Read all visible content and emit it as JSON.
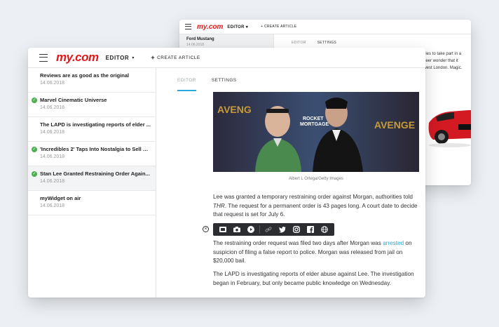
{
  "back_window": {
    "logo": "my.com",
    "editor_label": "EDITOR ▾",
    "create_label": "+ CREATE ARTICLE",
    "selected_article": {
      "title": "Ford Mustang",
      "date": "14.06.2018"
    },
    "tabs": [
      "EDITOR",
      "SETTINGS"
    ],
    "body_lines": [
      "l series to take part in a",
      "e sheer wonder that it",
      "on west London. Magic."
    ]
  },
  "header": {
    "logo": "my.com",
    "editor_label": "EDITOR",
    "caret": "▾",
    "create_plus": "+",
    "create_label": "CREATE ARTICLE"
  },
  "sidebar": {
    "items": [
      {
        "title": "Reviews are as good as the original",
        "date": "14.06.2018",
        "checked": false,
        "selected": false
      },
      {
        "title": "Marvel Cinematic Universe",
        "date": "14.06.2018",
        "checked": true,
        "selected": false
      },
      {
        "title": "The LAPD is investigating reports of elder ...",
        "date": "14.06.2018",
        "checked": false,
        "selected": false
      },
      {
        "title": "'Incredibles 2' Taps Into Nostalgia to Sell S...",
        "date": "14.06.2018",
        "checked": true,
        "selected": false
      },
      {
        "title": "Stan Lee Granted Restraining Order Again...",
        "date": "14.06.2018",
        "checked": true,
        "selected": true
      },
      {
        "title": "myWidget on air",
        "date": "14.06.2018",
        "checked": false,
        "selected": false
      }
    ]
  },
  "main": {
    "tabs": {
      "editor": "EDITOR",
      "settings": "SETTINGS"
    },
    "caption": "Albert L Ortega/Getty Images",
    "p1_a": "Lee was granted a temporary restraining order against Morgan, authorities told ",
    "p1_thr": "THR",
    "p1_b": ". The request for a permanent order is 43 pages long. A court date to decide that request is set for July 6.",
    "p2_a": "The restraining order request was filed two days after Morgan was ",
    "p2_link": "arrested",
    "p2_b": " on suspicion of filing a false report to police. Morgan was released from jail on $20,000 bail.",
    "p3": "The LAPD is investigating reports of elder abuse against Lee. The investigation began in February, but only became public knowledge on Wednesday."
  },
  "toolbar": {
    "close_symbol": "×",
    "icons": [
      "gallery-icon",
      "camera-icon",
      "play-icon",
      "link-icon",
      "twitter-icon",
      "instagram-icon",
      "facebook-icon",
      "globe-icon"
    ]
  },
  "colors": {
    "brand": "#e1191b",
    "accent": "#2aa8e0",
    "check": "#4caf50",
    "toolbar": "#2b2d31"
  }
}
